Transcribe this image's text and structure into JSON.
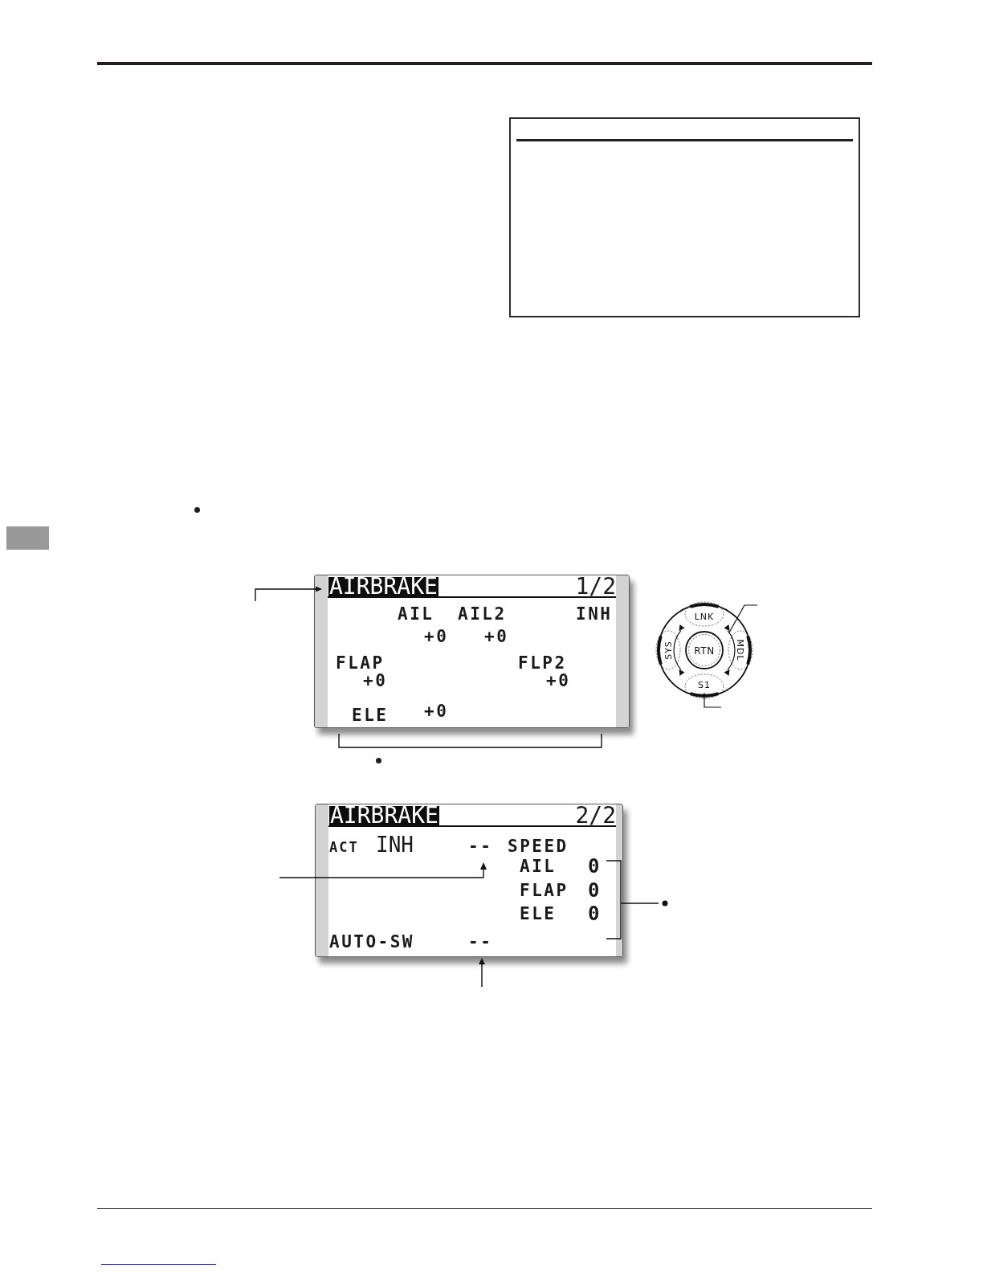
{
  "rates_screen": {
    "title": "AIRBRAKE",
    "page": "1/2",
    "status": "INH",
    "mixes": [
      {
        "label": "AIL",
        "rate": "+0"
      },
      {
        "label": "AIL2",
        "rate": "+0"
      },
      {
        "label": "FLAP",
        "rate": "+0"
      },
      {
        "label": "FLP2",
        "rate": "+0"
      },
      {
        "label": "ELE",
        "rate": "+0"
      }
    ]
  },
  "dial": {
    "top": "LNK",
    "right": "MDL",
    "bottom": "S1",
    "left": "SYS",
    "center": "RTN"
  },
  "settings_screen": {
    "title": "AIRBRAKE",
    "page": "2/2",
    "act_label": "ACT",
    "act_state": "INH",
    "act_switch": "--",
    "speed_label": "SPEED",
    "speeds": [
      {
        "label": "AIL",
        "value": "0"
      },
      {
        "label": "FLAP",
        "value": "0"
      },
      {
        "label": "ELE",
        "value": "0"
      }
    ],
    "auto_switch_label": "AUTO-SW",
    "auto_switch": "--"
  }
}
